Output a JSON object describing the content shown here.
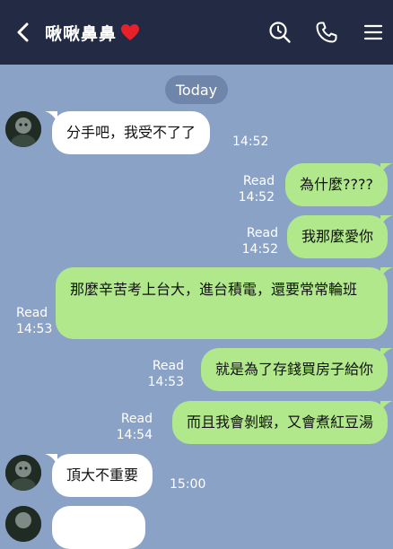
{
  "header": {
    "title": "啾啾鼻鼻",
    "bg_color": "#232a44"
  },
  "date_divider": "Today",
  "colors": {
    "chat_bg": "#8aa2c6",
    "incoming_bubble": "#ffffff",
    "outgoing_bubble": "#b1e88c",
    "heart": "#e8202a"
  },
  "messages": [
    {
      "direction": "in",
      "text": "分手吧，我受不了了",
      "time": "14:52"
    },
    {
      "direction": "out",
      "text": "為什麼????",
      "read": "Read",
      "time": "14:52"
    },
    {
      "direction": "out",
      "text": "我那麼愛你",
      "read": "Read",
      "time": "14:52"
    },
    {
      "direction": "out",
      "text": "那麼辛苦考上台大，進台積電，還要常常輪班",
      "read": "Read",
      "time": "14:53"
    },
    {
      "direction": "out",
      "text": "就是為了存錢買房子給你",
      "read": "Read",
      "time": "14:53"
    },
    {
      "direction": "out",
      "text": "而且我會剝蝦，又會煮紅豆湯",
      "read": "Read",
      "time": "14:54"
    },
    {
      "direction": "in",
      "text": "頂大不重要",
      "time": "15:00"
    }
  ]
}
